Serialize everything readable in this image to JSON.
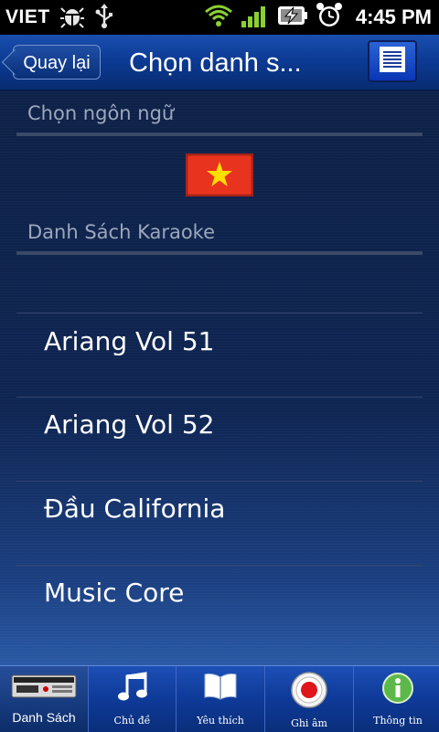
{
  "status_bar": {
    "carrier": "VIET",
    "time": "4:45 PM",
    "icons": [
      "debug-icon",
      "usb-icon",
      "wifi-icon",
      "signal-icon",
      "battery-charging-icon",
      "alarm-icon"
    ]
  },
  "title_bar": {
    "back_label": "Quay lại",
    "title": "Chọn danh s...",
    "menu_icon": "list-icon"
  },
  "language_section": {
    "header": "Chọn ngôn ngữ",
    "flag_icon": "vietnam-flag-icon"
  },
  "karaoke_section": {
    "header": "Danh Sách Karaoke",
    "items": [
      {
        "label": "Ariang Vol 51"
      },
      {
        "label": "Ariang Vol 52"
      },
      {
        "label": "Đầu California"
      },
      {
        "label": "Music Core"
      }
    ]
  },
  "tab_bar": {
    "tabs": [
      {
        "label": "Danh Sách",
        "icon": "karaoke-player-icon",
        "active": true
      },
      {
        "label": "Chủ đề",
        "icon": "music-note-icon",
        "active": false
      },
      {
        "label": "Yêu thích",
        "icon": "book-icon",
        "active": false
      },
      {
        "label": "Ghi âm",
        "icon": "record-icon",
        "active": false
      },
      {
        "label": "Thông tin",
        "icon": "info-icon",
        "active": false
      }
    ]
  },
  "colors": {
    "accent": "#0c3b95",
    "flag_red": "#e8331f",
    "flag_star": "#ffde00",
    "record_red": "#e0141b",
    "info_green": "#5db84a"
  }
}
